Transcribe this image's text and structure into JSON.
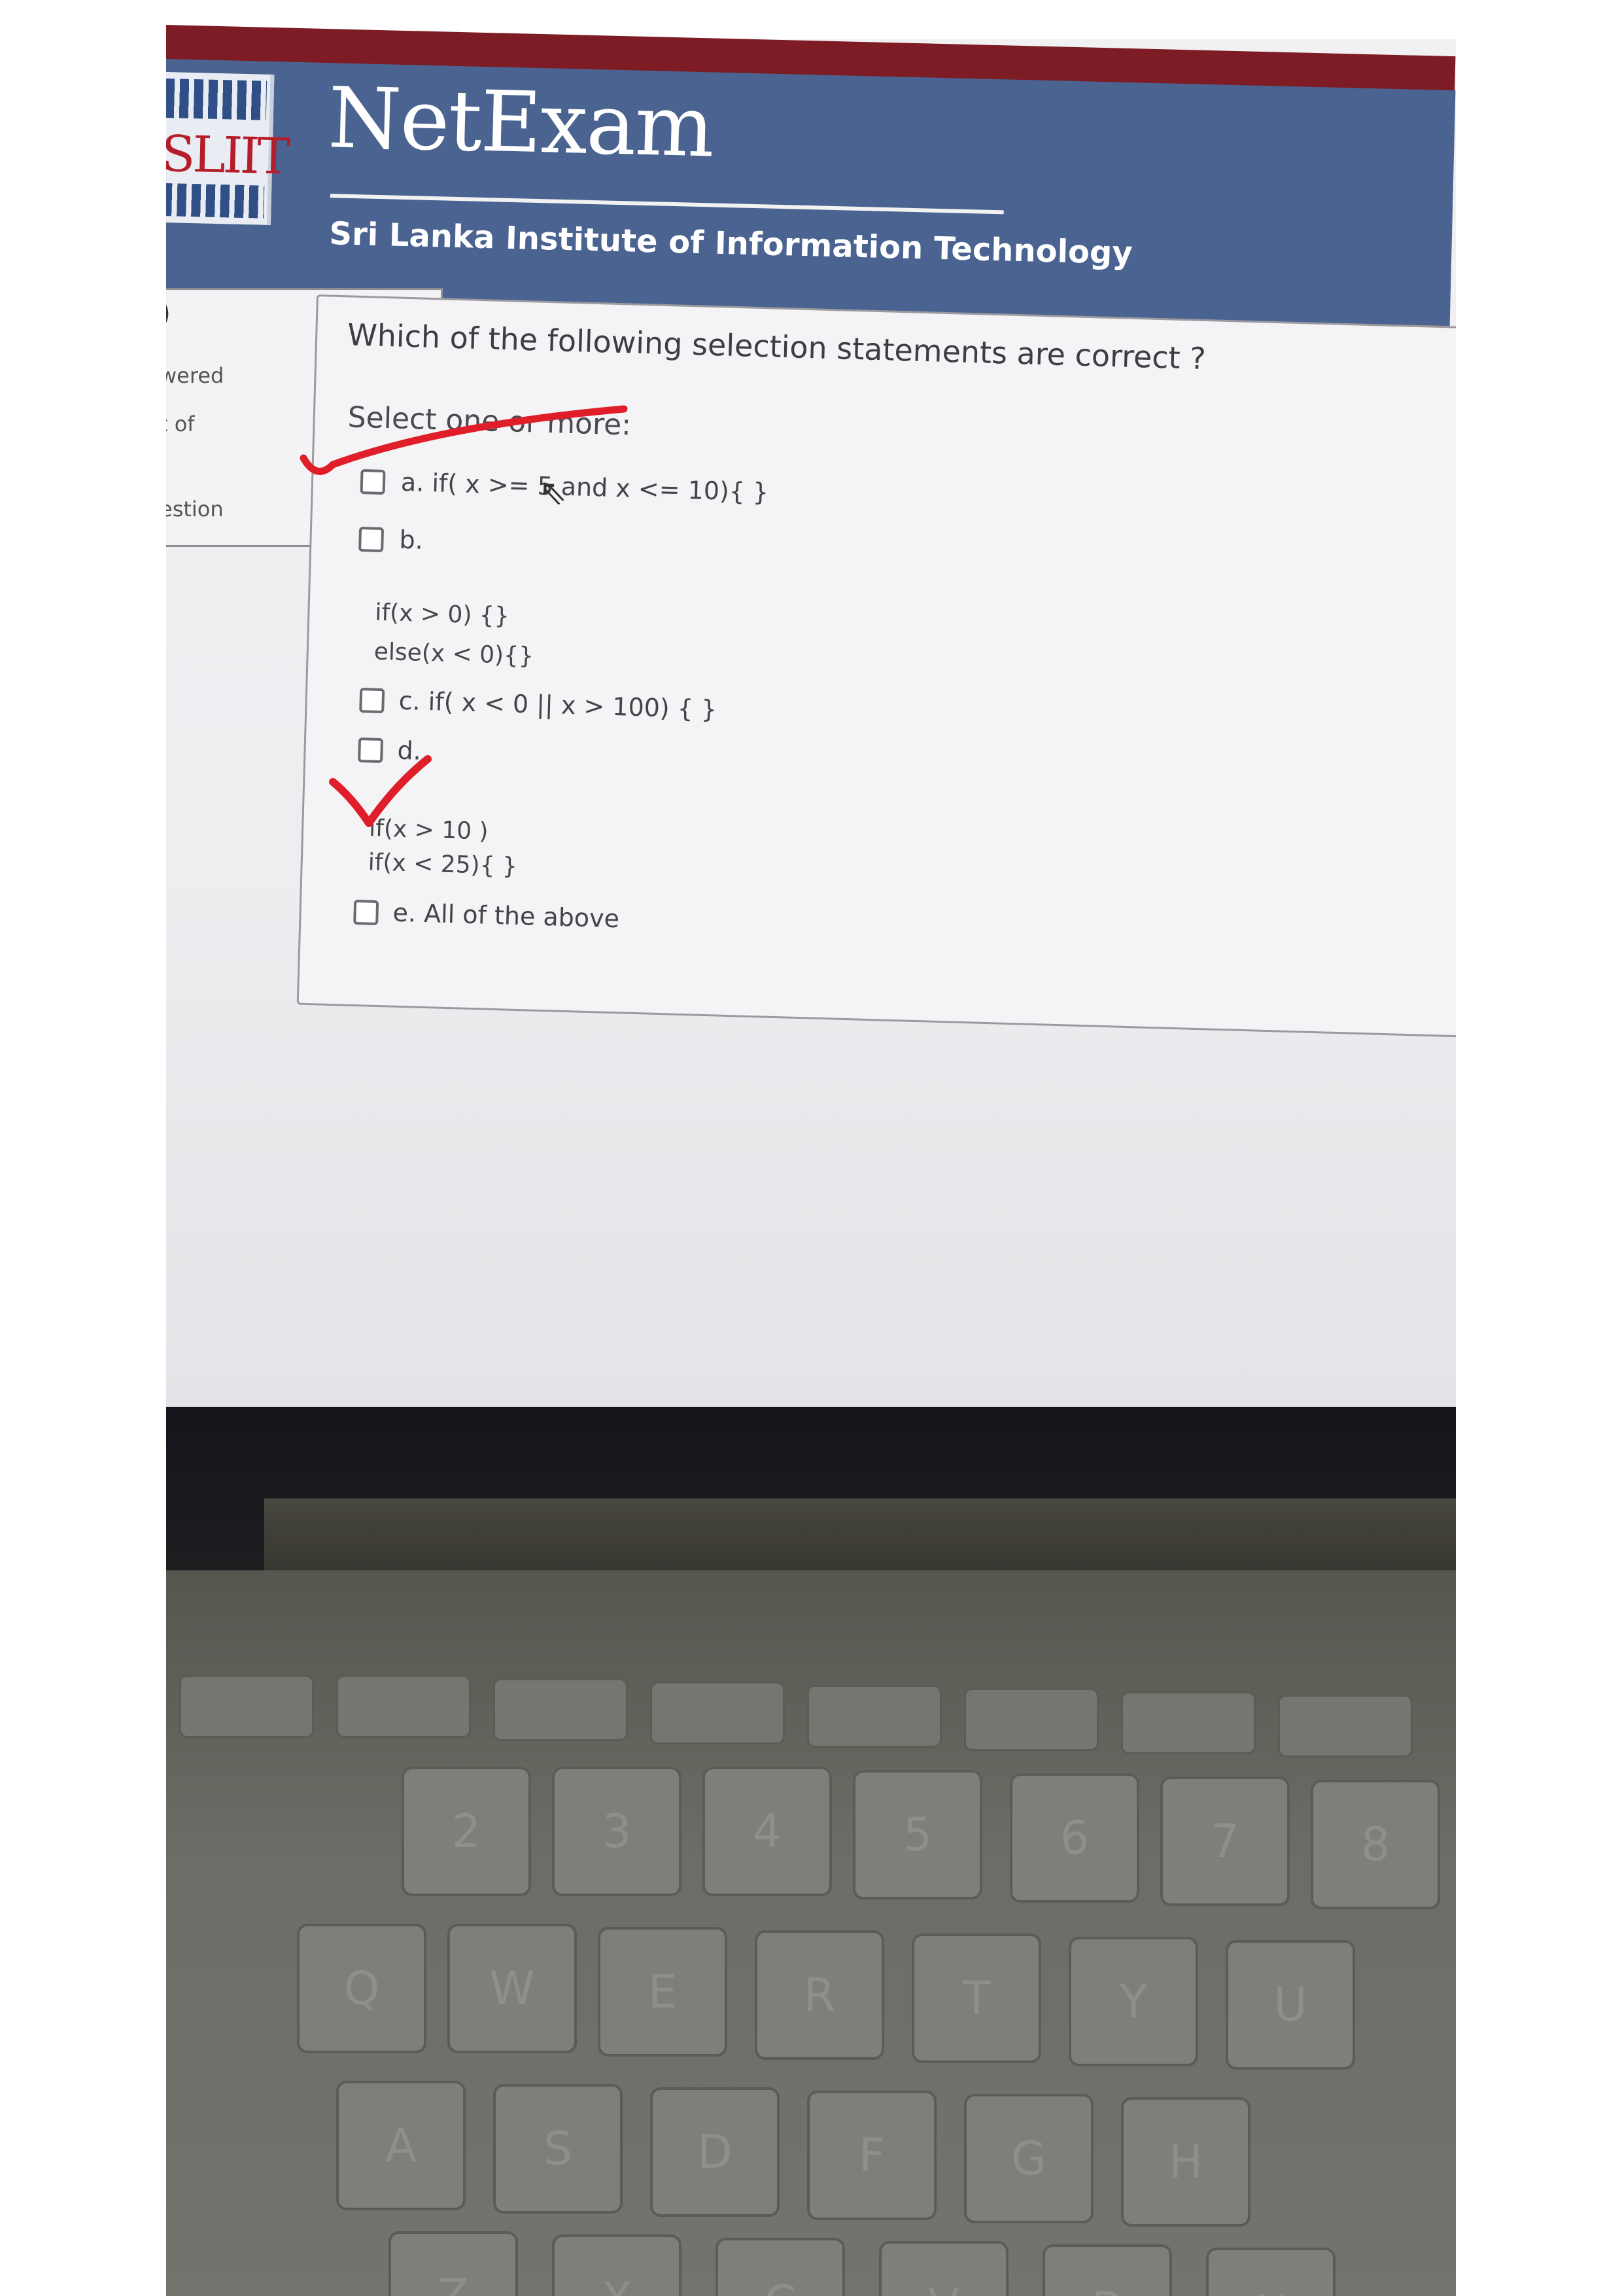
{
  "header": {
    "logo_text": "SLIIT",
    "brand_title": "NetExam",
    "subtitle": "Sri Lanka Institute of Information Technology"
  },
  "sidebar": {
    "fragments": [
      ")",
      "wered",
      "t of",
      "estion"
    ]
  },
  "question": {
    "text": "Which of the following selection statements are correct ?",
    "instruction": "Select one or more:",
    "options": [
      {
        "label": "a. if( x >= 5 and x <= 10){ }",
        "checked": false
      },
      {
        "label": "b.",
        "code": [
          "if(x > 0) {}",
          "else(x < 0){}"
        ],
        "checked": false
      },
      {
        "label": "c. if( x < 0 || x > 100) { }",
        "checked": false
      },
      {
        "label": "d.",
        "code": [
          "if(x > 10 )",
          "if(x < 25){ }"
        ],
        "checked": false
      },
      {
        "label": "e. All of the above",
        "checked": false
      }
    ]
  },
  "annotations": {
    "tick_color": "#e01e2a"
  },
  "keyboard": {
    "number_row": [
      "2",
      "3",
      "4",
      "5",
      "6",
      "7",
      "8"
    ],
    "top_row": [
      "Q",
      "W",
      "E",
      "R",
      "T",
      "Y",
      "U"
    ],
    "home_row": [
      "A",
      "S",
      "D",
      "F",
      "G",
      "H"
    ],
    "bottom_row": [
      "Z",
      "X",
      "C",
      "V",
      "B",
      "N"
    ]
  },
  "colors": {
    "header_blue": "#4a6390",
    "header_maroon": "#7d1c24",
    "accent_orange": "#e0902a"
  }
}
